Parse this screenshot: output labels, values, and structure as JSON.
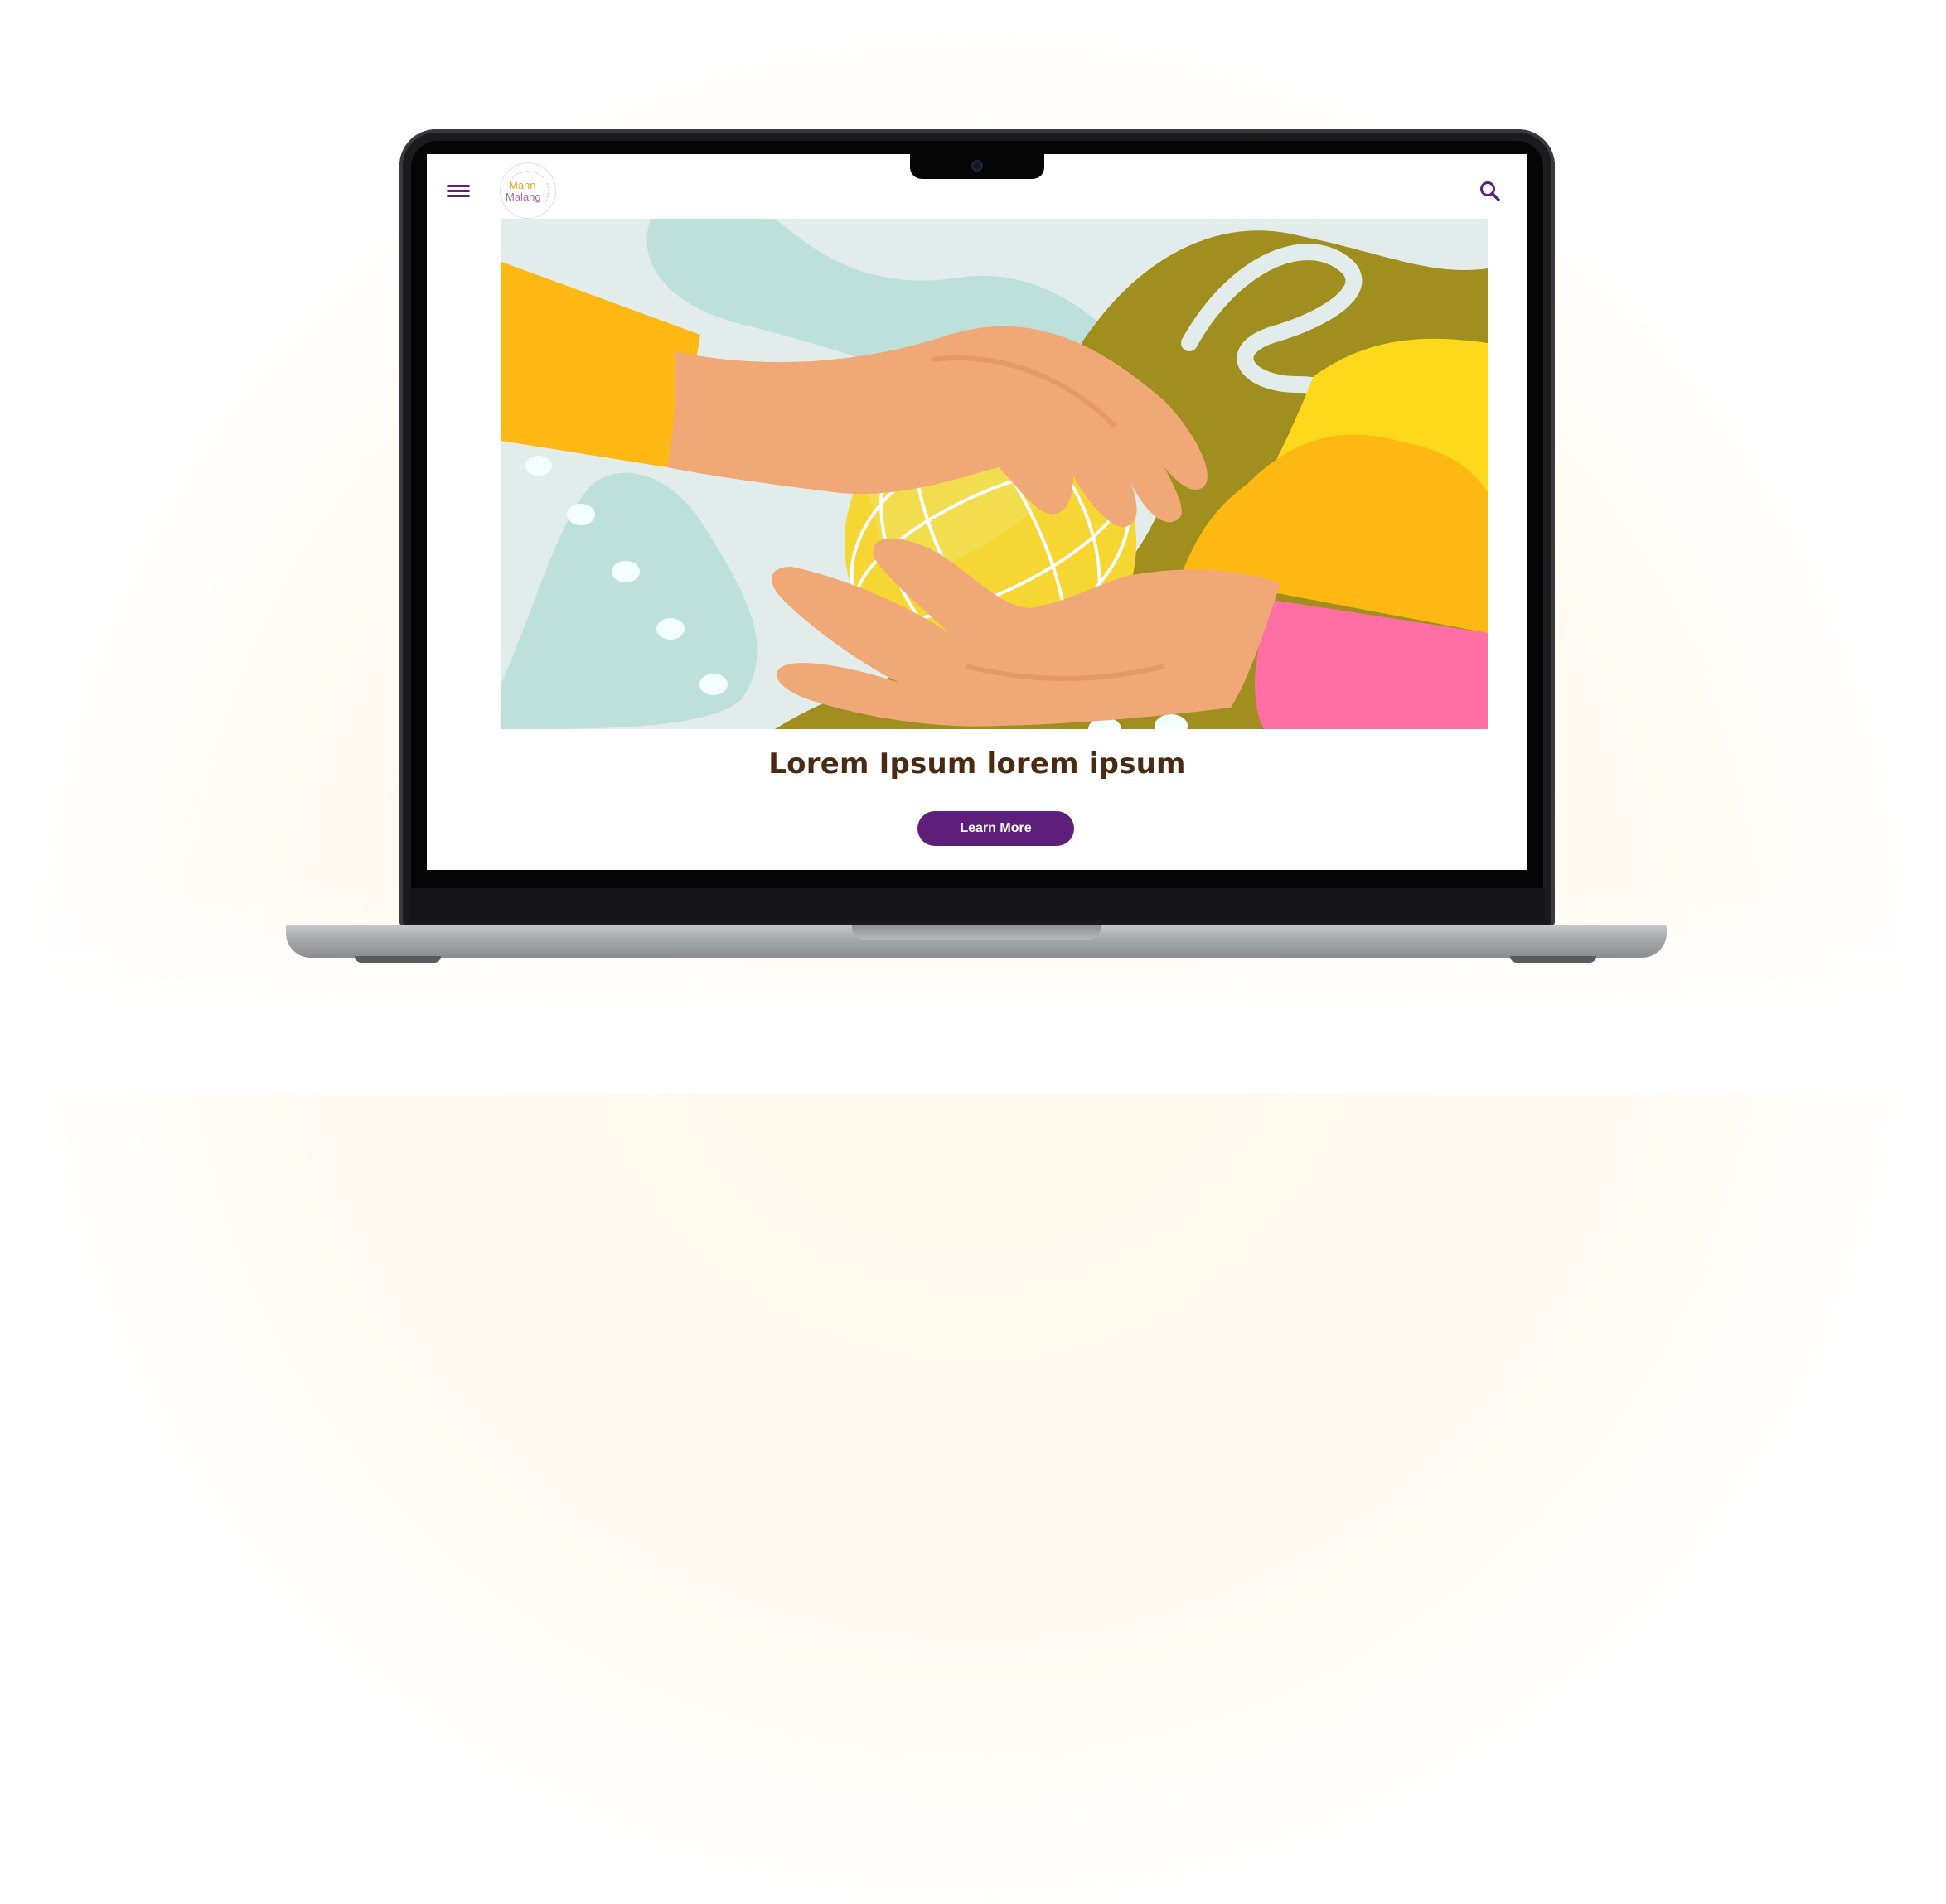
{
  "site": {
    "logo_line1": "Mann",
    "logo_line2": "Malang"
  },
  "hero": {
    "headline": "Lorem Ipsum lorem  ipsum",
    "cta_label": "Learn More"
  },
  "icons": {
    "menu": "hamburger-menu-icon",
    "search": "search-icon",
    "camera": "camera-icon"
  },
  "colors": {
    "brand_purple": "#5e1f7a",
    "headline_brown": "#4a2a12",
    "sleeve_yellow": "#fdb813",
    "sleeve_pink": "#ff6fa3",
    "globe_yellow": "#f5d632",
    "olive": "#a08e1e",
    "mint": "#bfe0dc",
    "skin": "#efa876"
  }
}
